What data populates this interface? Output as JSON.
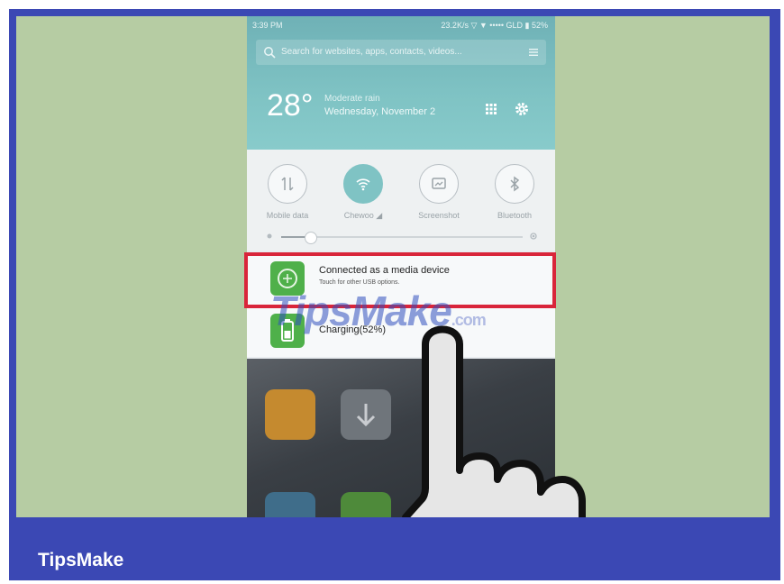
{
  "status_bar": {
    "time": "3:39 PM",
    "right": "23.2K/s ▽ ▼ ••••• GLD ▮ 52%"
  },
  "search": {
    "placeholder": "Search for websites, apps, contacts, videos..."
  },
  "weather": {
    "temperature": "28°",
    "condition": "Moderate rain",
    "date": "Wednesday, November 2"
  },
  "toggles": [
    {
      "label": "Mobile data",
      "icon": "mobile-data-icon",
      "on": false
    },
    {
      "label": "Chewoo ◢",
      "icon": "wifi-icon",
      "on": true
    },
    {
      "label": "Screenshot",
      "icon": "screenshot-icon",
      "on": false
    },
    {
      "label": "Bluetooth",
      "icon": "bluetooth-icon",
      "on": false
    }
  ],
  "brightness": {
    "level": 0.12
  },
  "notifications": [
    {
      "title": "Connected as a media device",
      "subtitle": "Touch for other USB options.",
      "icon": "usb-icon"
    },
    {
      "title": "Charging(52%)",
      "icon": "battery-icon"
    }
  ],
  "watermark": {
    "text": "TipsMake",
    "suffix": ".com"
  },
  "footer": {
    "brand": "TipsMake"
  },
  "colors": {
    "frame": "#3b48b4",
    "background": "#b6cca3",
    "header": "#7fc3c4",
    "highlight": "#d9253a",
    "notif_icon": "#4fb04a"
  }
}
